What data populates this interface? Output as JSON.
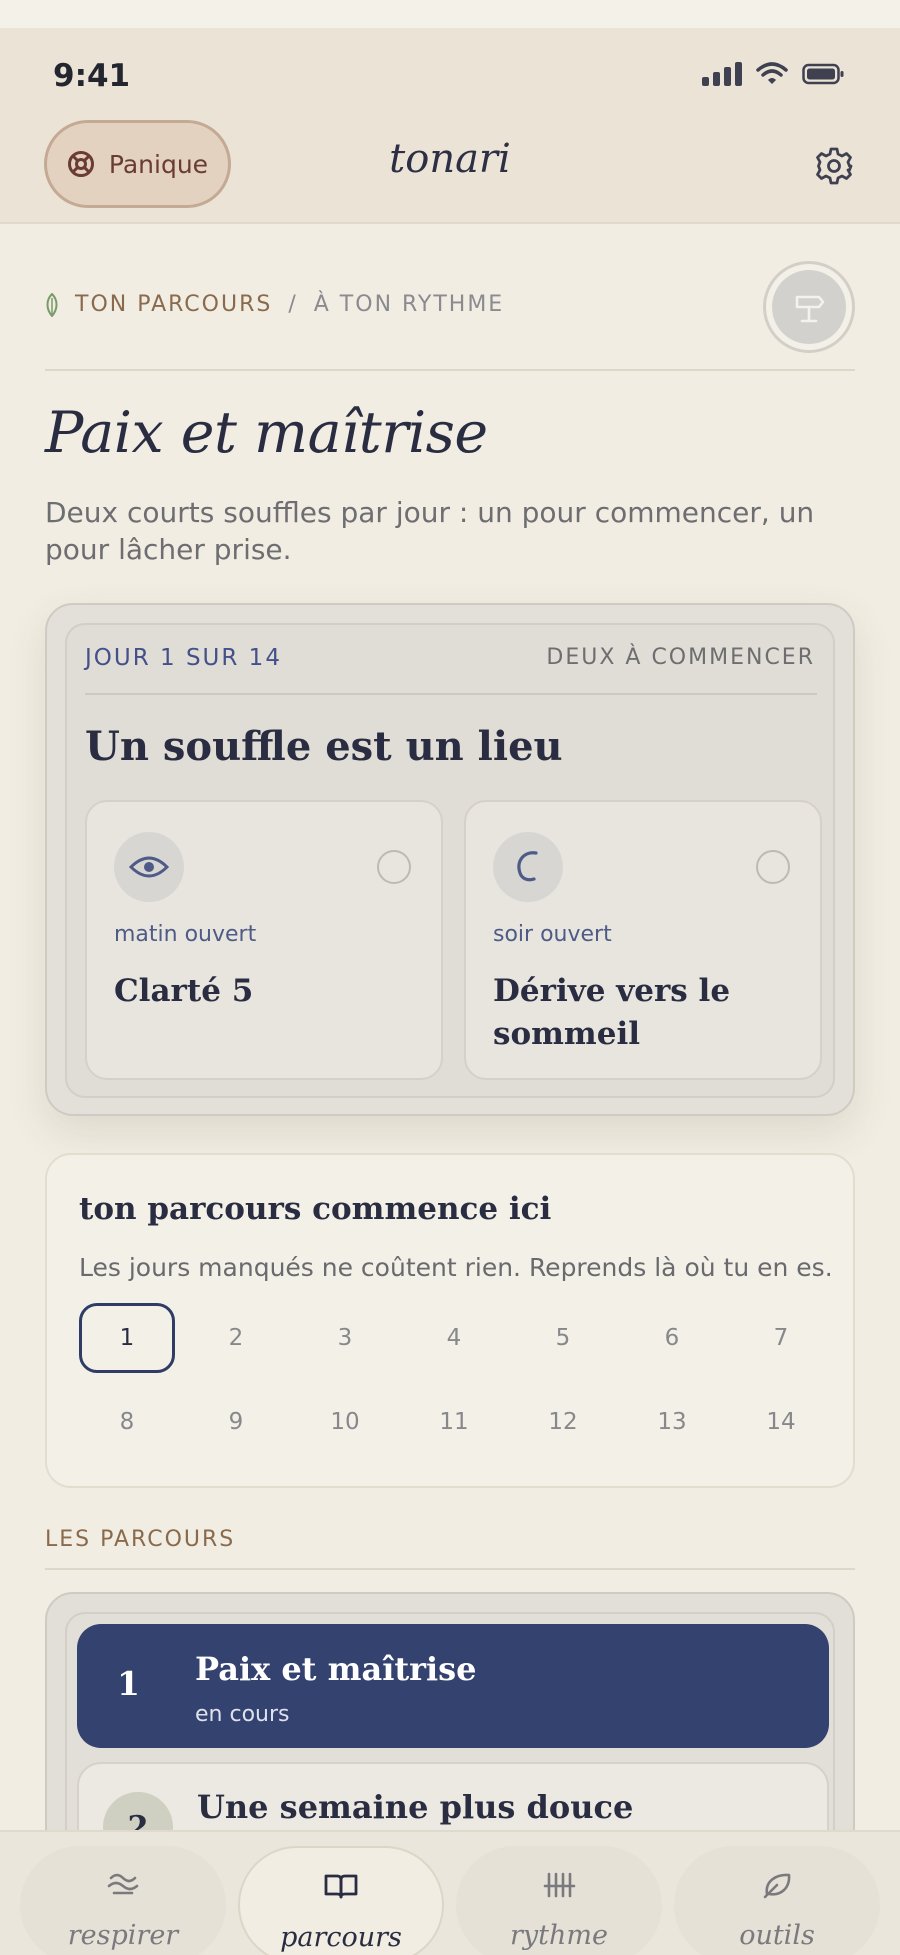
{
  "status_bar": {
    "time": "9:41"
  },
  "header": {
    "panic_label": "Panique",
    "brand": "tonari"
  },
  "breadcrumb": {
    "part1": "TON PARCOURS",
    "separator": "/",
    "part2": "À TON RYTHME"
  },
  "page": {
    "title": "Paix et maîtrise",
    "subtitle": "Deux courts souffles par jour : un pour commencer, un pour lâcher prise."
  },
  "day_card": {
    "count": "JOUR 1 SUR 14",
    "tag": "DEUX À COMMENCER",
    "title": "Un souffle est un lieu",
    "sessions": [
      {
        "when": "matin ouvert",
        "name": "Clarté 5",
        "icon": "eye-icon"
      },
      {
        "when": "soir ouvert",
        "name": "Dérive vers le sommeil",
        "icon": "crescent-icon"
      }
    ]
  },
  "journey": {
    "title": "ton parcours commence ici",
    "subtitle": "Les jours manqués ne coûtent rien. Reprends là où tu en es.",
    "days": [
      "1",
      "2",
      "3",
      "4",
      "5",
      "6",
      "7",
      "8",
      "9",
      "10",
      "11",
      "12",
      "13",
      "14"
    ],
    "current_day": "1"
  },
  "parcours": {
    "section_label": "LES PARCOURS",
    "items": [
      {
        "number": "1",
        "title": "Paix et maîtrise",
        "status": "en cours"
      },
      {
        "number": "2",
        "title": "Une semaine plus douce"
      }
    ]
  },
  "tabs": [
    {
      "label": "respirer",
      "icon": "breath-icon"
    },
    {
      "label": "parcours",
      "icon": "book-icon"
    },
    {
      "label": "rythme",
      "icon": "tally-icon"
    },
    {
      "label": "outils",
      "icon": "leaf-icon"
    }
  ],
  "colors": {
    "accent_navy": "#34426f",
    "panic_bg": "#e3d2c0",
    "background": "#f1ede2",
    "earth_label": "#8a6a4c"
  }
}
